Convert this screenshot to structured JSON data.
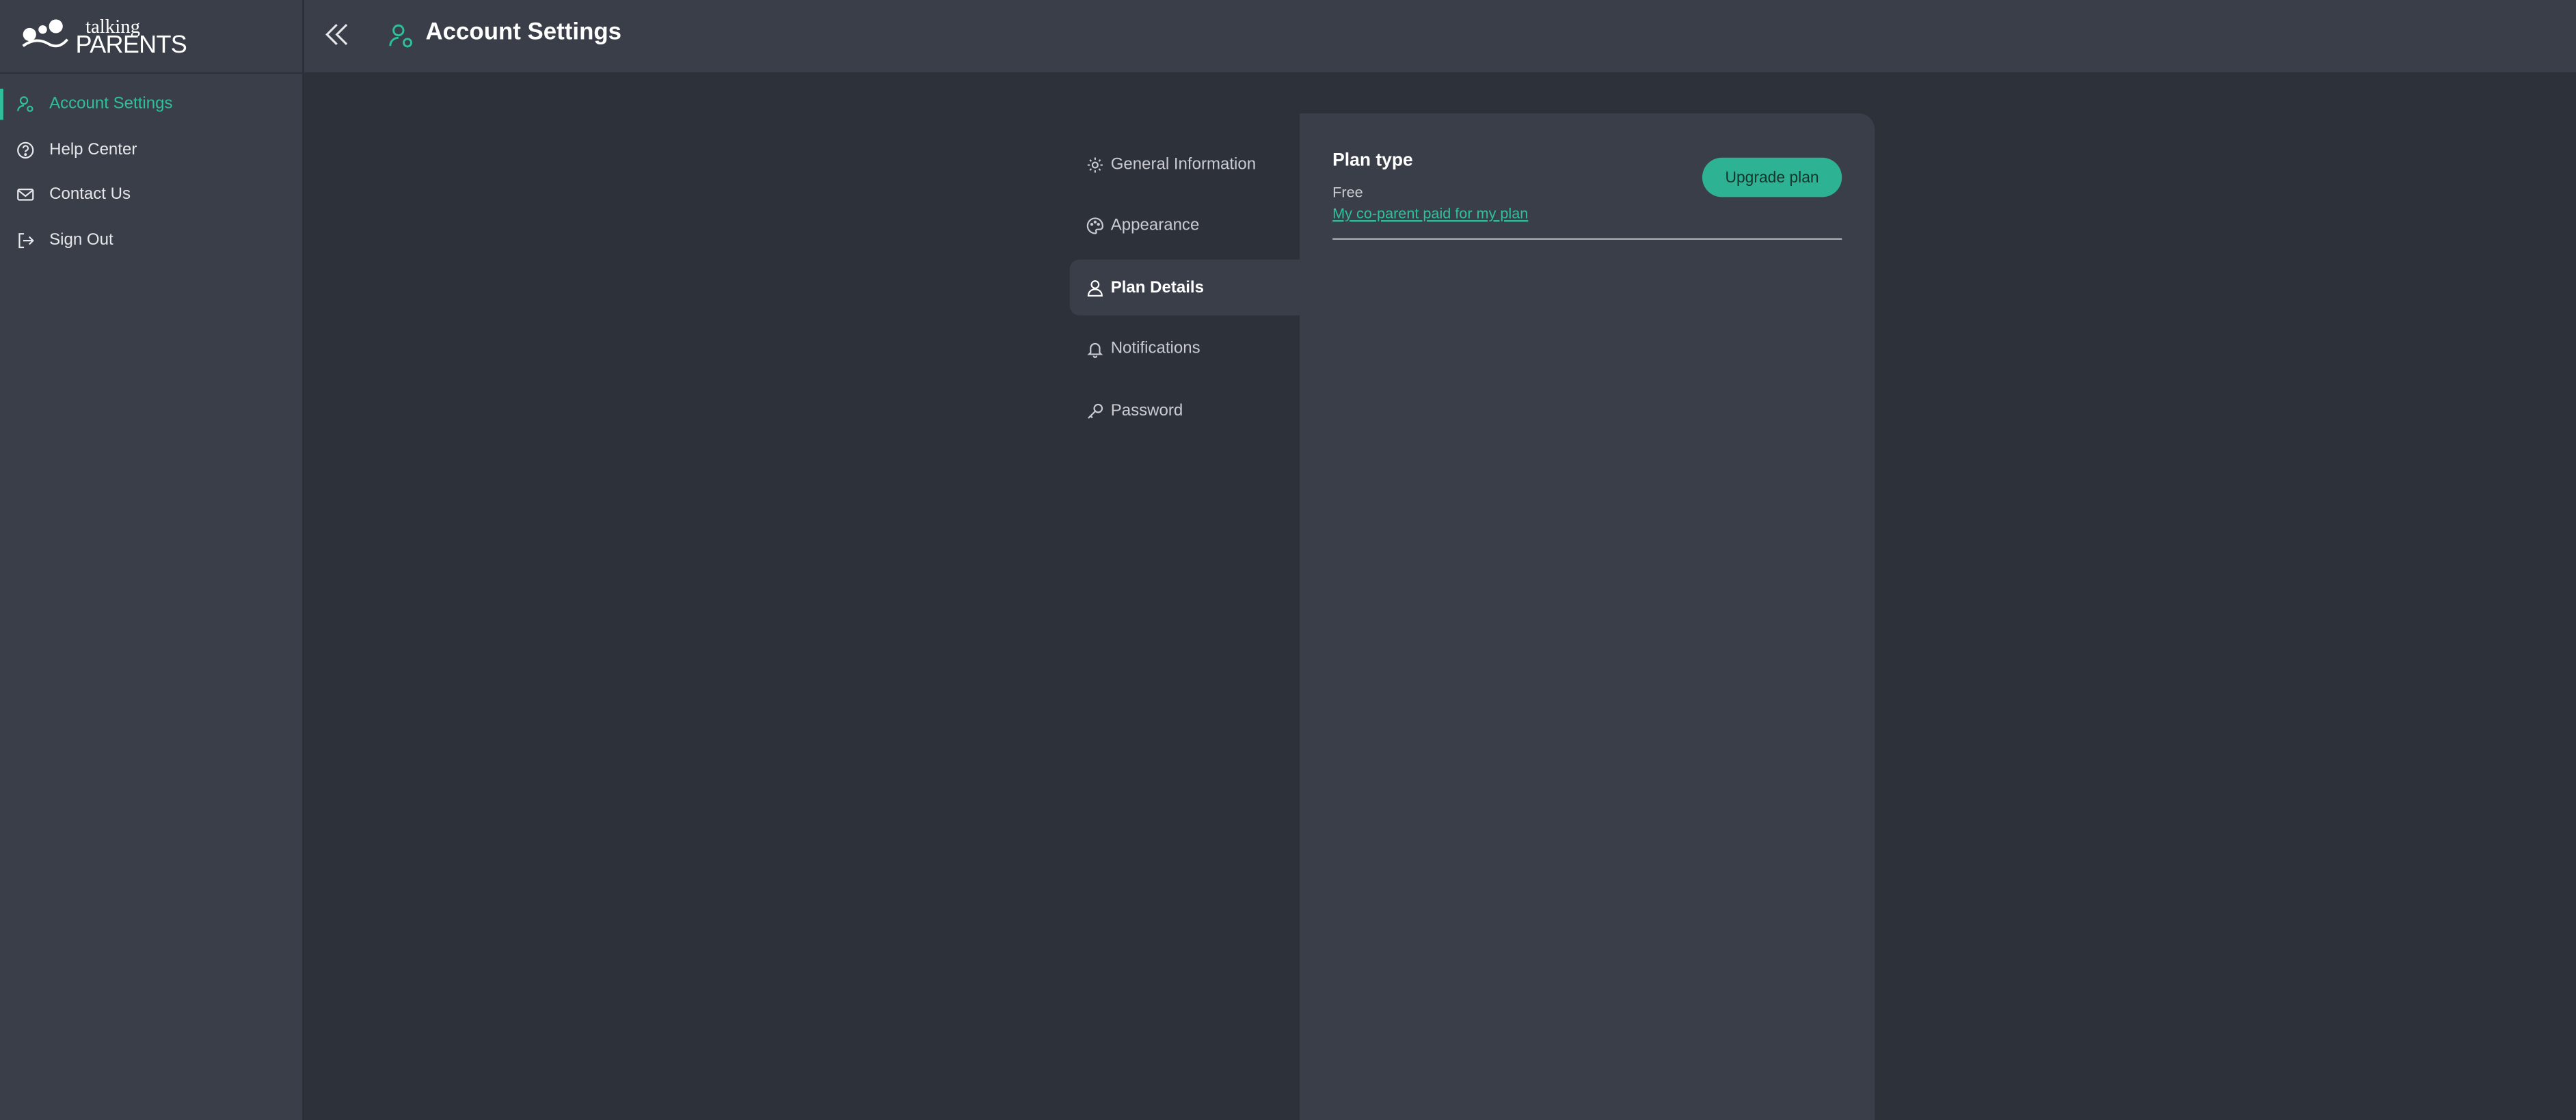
{
  "brand": {
    "logo_small": "talking",
    "logo_big": "PARENTS"
  },
  "sidebar": {
    "items": [
      {
        "label": "Account Settings",
        "icon": "user-gear-icon",
        "active": true
      },
      {
        "label": "Help Center",
        "icon": "help-circle-icon",
        "active": false
      },
      {
        "label": "Contact Us",
        "icon": "mail-icon",
        "active": false
      },
      {
        "label": "Sign Out",
        "icon": "sign-out-icon",
        "active": false
      }
    ]
  },
  "header": {
    "title": "Account Settings",
    "icon": "user-gear-icon"
  },
  "tabs": [
    {
      "label": "General Information",
      "icon": "gear-icon",
      "active": false
    },
    {
      "label": "Appearance",
      "icon": "palette-icon",
      "active": false
    },
    {
      "label": "Plan Details",
      "icon": "user-icon",
      "active": true
    },
    {
      "label": "Notifications",
      "icon": "bell-icon",
      "active": false
    },
    {
      "label": "Password",
      "icon": "key-icon",
      "active": false
    }
  ],
  "plan": {
    "heading": "Plan type",
    "value": "Free",
    "link": "My co-parent paid for my plan",
    "upgrade_label": "Upgrade plan"
  },
  "colors": {
    "accent": "#2fc09a",
    "button": "#2db393",
    "background": "#2d313a",
    "surface": "#3a3e49"
  }
}
